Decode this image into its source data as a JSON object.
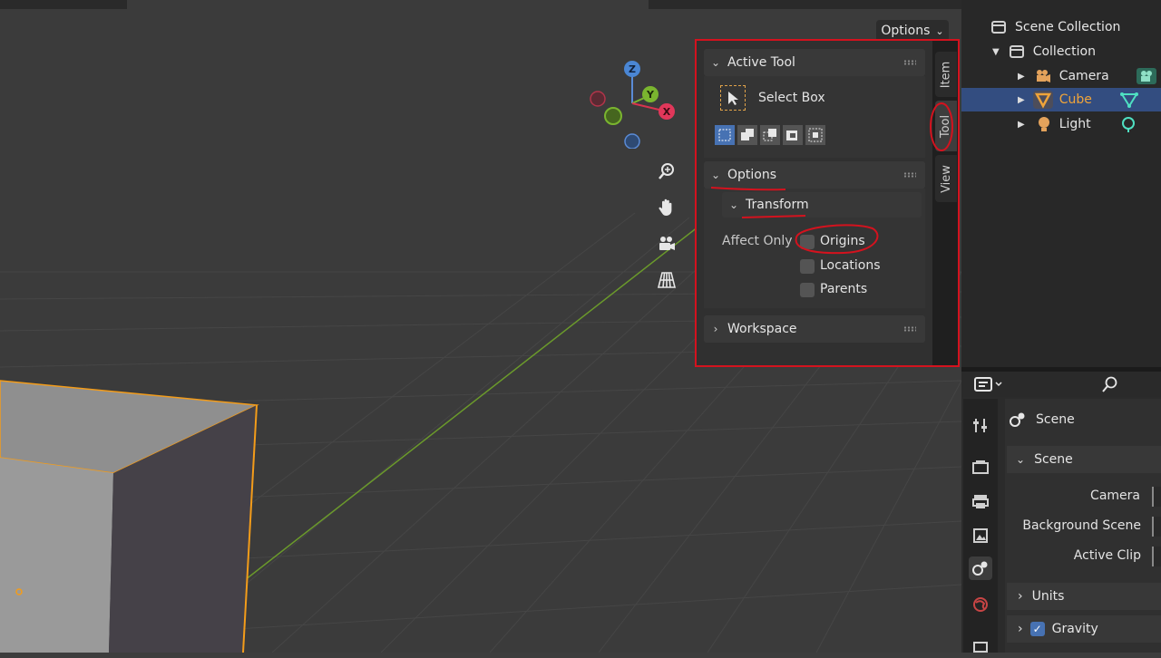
{
  "viewport": {
    "options_label": "Options",
    "colors": {
      "bg": "#3b3b3b",
      "grid": "#454545",
      "y_axis": "#6b9a2b",
      "selected_outline": "#f39c1a",
      "annotation_red": "#d4121e"
    }
  },
  "gizmo": {
    "z": "Z",
    "y": "Y",
    "x": "X"
  },
  "npanel": {
    "tabs": {
      "item": "Item",
      "tool": "Tool",
      "view": "View"
    },
    "active_tool": {
      "header": "Active Tool",
      "tool_name": "Select Box"
    },
    "options": {
      "header": "Options",
      "transform": {
        "header": "Transform",
        "affect_only_label": "Affect Only",
        "origins": "Origins",
        "locations": "Locations",
        "parents": "Parents"
      }
    },
    "workspace": {
      "header": "Workspace"
    }
  },
  "outliner": {
    "scene_collection": "Scene Collection",
    "collection": "Collection",
    "items": [
      "Camera",
      "Cube",
      "Light"
    ]
  },
  "properties": {
    "scene_title": "Scene",
    "scene_section": "Scene",
    "fields": {
      "camera": "Camera",
      "background_scene": "Background Scene",
      "active_clip": "Active Clip"
    },
    "units": "Units",
    "gravity": "Gravity"
  }
}
